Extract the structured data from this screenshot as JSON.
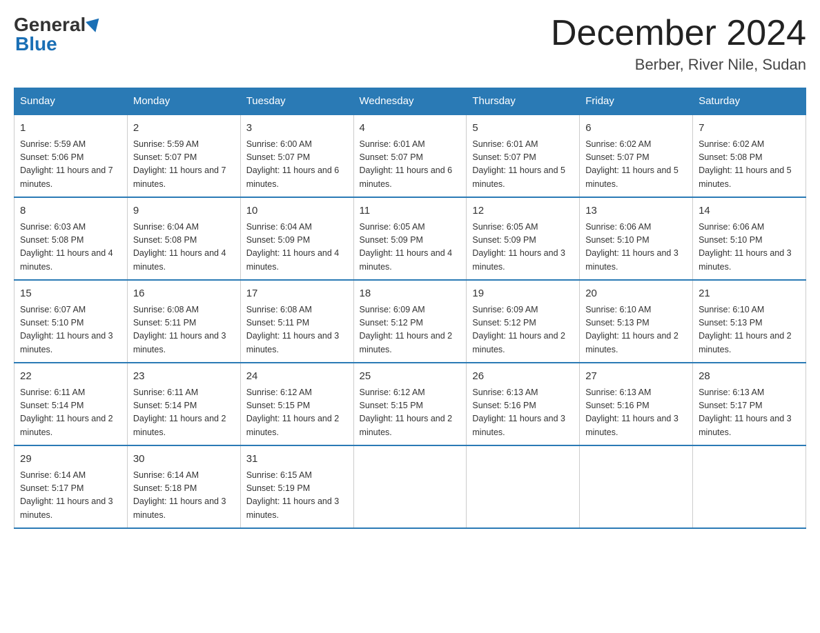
{
  "logo": {
    "general": "General",
    "blue": "Blue"
  },
  "title": {
    "month_year": "December 2024",
    "location": "Berber, River Nile, Sudan"
  },
  "days_header": [
    "Sunday",
    "Monday",
    "Tuesday",
    "Wednesday",
    "Thursday",
    "Friday",
    "Saturday"
  ],
  "weeks": [
    [
      {
        "day": "1",
        "sunrise": "5:59 AM",
        "sunset": "5:06 PM",
        "daylight": "11 hours and 7 minutes."
      },
      {
        "day": "2",
        "sunrise": "5:59 AM",
        "sunset": "5:07 PM",
        "daylight": "11 hours and 7 minutes."
      },
      {
        "day": "3",
        "sunrise": "6:00 AM",
        "sunset": "5:07 PM",
        "daylight": "11 hours and 6 minutes."
      },
      {
        "day": "4",
        "sunrise": "6:01 AM",
        "sunset": "5:07 PM",
        "daylight": "11 hours and 6 minutes."
      },
      {
        "day": "5",
        "sunrise": "6:01 AM",
        "sunset": "5:07 PM",
        "daylight": "11 hours and 5 minutes."
      },
      {
        "day": "6",
        "sunrise": "6:02 AM",
        "sunset": "5:07 PM",
        "daylight": "11 hours and 5 minutes."
      },
      {
        "day": "7",
        "sunrise": "6:02 AM",
        "sunset": "5:08 PM",
        "daylight": "11 hours and 5 minutes."
      }
    ],
    [
      {
        "day": "8",
        "sunrise": "6:03 AM",
        "sunset": "5:08 PM",
        "daylight": "11 hours and 4 minutes."
      },
      {
        "day": "9",
        "sunrise": "6:04 AM",
        "sunset": "5:08 PM",
        "daylight": "11 hours and 4 minutes."
      },
      {
        "day": "10",
        "sunrise": "6:04 AM",
        "sunset": "5:09 PM",
        "daylight": "11 hours and 4 minutes."
      },
      {
        "day": "11",
        "sunrise": "6:05 AM",
        "sunset": "5:09 PM",
        "daylight": "11 hours and 4 minutes."
      },
      {
        "day": "12",
        "sunrise": "6:05 AM",
        "sunset": "5:09 PM",
        "daylight": "11 hours and 3 minutes."
      },
      {
        "day": "13",
        "sunrise": "6:06 AM",
        "sunset": "5:10 PM",
        "daylight": "11 hours and 3 minutes."
      },
      {
        "day": "14",
        "sunrise": "6:06 AM",
        "sunset": "5:10 PM",
        "daylight": "11 hours and 3 minutes."
      }
    ],
    [
      {
        "day": "15",
        "sunrise": "6:07 AM",
        "sunset": "5:10 PM",
        "daylight": "11 hours and 3 minutes."
      },
      {
        "day": "16",
        "sunrise": "6:08 AM",
        "sunset": "5:11 PM",
        "daylight": "11 hours and 3 minutes."
      },
      {
        "day": "17",
        "sunrise": "6:08 AM",
        "sunset": "5:11 PM",
        "daylight": "11 hours and 3 minutes."
      },
      {
        "day": "18",
        "sunrise": "6:09 AM",
        "sunset": "5:12 PM",
        "daylight": "11 hours and 2 minutes."
      },
      {
        "day": "19",
        "sunrise": "6:09 AM",
        "sunset": "5:12 PM",
        "daylight": "11 hours and 2 minutes."
      },
      {
        "day": "20",
        "sunrise": "6:10 AM",
        "sunset": "5:13 PM",
        "daylight": "11 hours and 2 minutes."
      },
      {
        "day": "21",
        "sunrise": "6:10 AM",
        "sunset": "5:13 PM",
        "daylight": "11 hours and 2 minutes."
      }
    ],
    [
      {
        "day": "22",
        "sunrise": "6:11 AM",
        "sunset": "5:14 PM",
        "daylight": "11 hours and 2 minutes."
      },
      {
        "day": "23",
        "sunrise": "6:11 AM",
        "sunset": "5:14 PM",
        "daylight": "11 hours and 2 minutes."
      },
      {
        "day": "24",
        "sunrise": "6:12 AM",
        "sunset": "5:15 PM",
        "daylight": "11 hours and 2 minutes."
      },
      {
        "day": "25",
        "sunrise": "6:12 AM",
        "sunset": "5:15 PM",
        "daylight": "11 hours and 2 minutes."
      },
      {
        "day": "26",
        "sunrise": "6:13 AM",
        "sunset": "5:16 PM",
        "daylight": "11 hours and 3 minutes."
      },
      {
        "day": "27",
        "sunrise": "6:13 AM",
        "sunset": "5:16 PM",
        "daylight": "11 hours and 3 minutes."
      },
      {
        "day": "28",
        "sunrise": "6:13 AM",
        "sunset": "5:17 PM",
        "daylight": "11 hours and 3 minutes."
      }
    ],
    [
      {
        "day": "29",
        "sunrise": "6:14 AM",
        "sunset": "5:17 PM",
        "daylight": "11 hours and 3 minutes."
      },
      {
        "day": "30",
        "sunrise": "6:14 AM",
        "sunset": "5:18 PM",
        "daylight": "11 hours and 3 minutes."
      },
      {
        "day": "31",
        "sunrise": "6:15 AM",
        "sunset": "5:19 PM",
        "daylight": "11 hours and 3 minutes."
      },
      null,
      null,
      null,
      null
    ]
  ]
}
